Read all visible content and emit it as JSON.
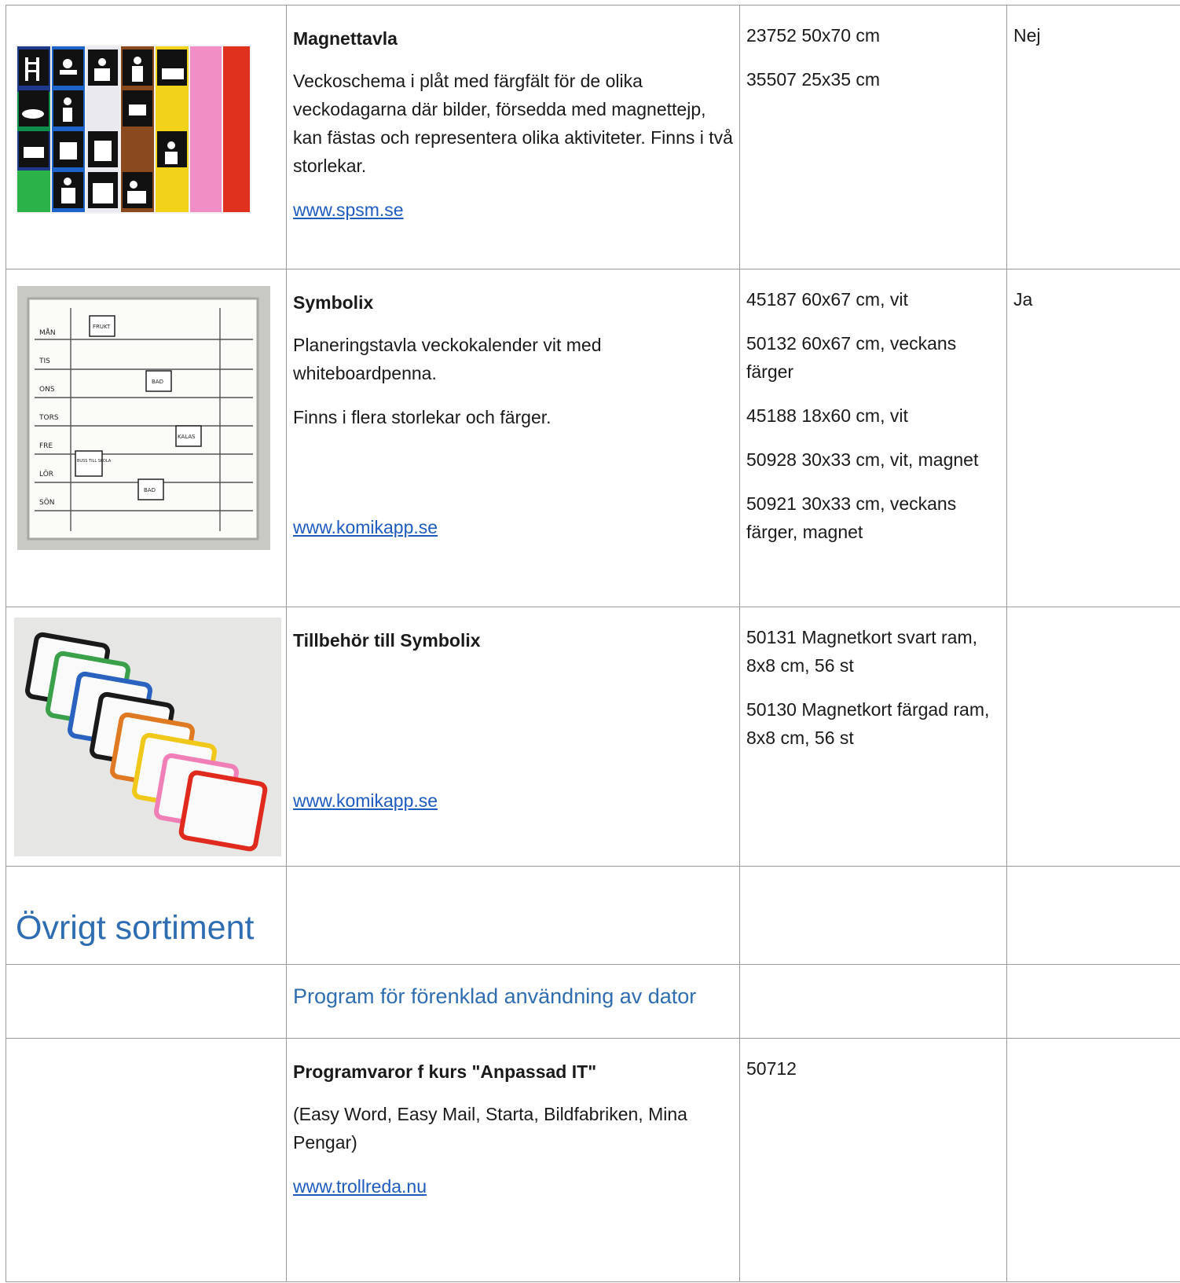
{
  "rows": [
    {
      "title": "Magnettavla",
      "description": "Veckoschema i plåt med färgfält för de olika veckodagarna där bilder, försedda med magnettejp, kan fästas och representera olika aktiviteter. Finns i två storlekar.",
      "link": "www.spsm.se",
      "articles": [
        "23752 50x70 cm",
        "35507 25x35 cm"
      ],
      "extra": "Nej"
    },
    {
      "title": "Symbolix",
      "description": "Planeringstavla veckokalender vit med whiteboardpenna.",
      "description2": "Finns i flera storlekar och färger.",
      "link": "www.komikapp.se",
      "articles": [
        "45187 60x67 cm, vit",
        "50132 60x67 cm, veckans färger",
        "45188 18x60 cm, vit",
        "50928 30x33 cm, vit, magnet",
        "50921 30x33 cm, veckans färger, magnet"
      ],
      "extra": "Ja",
      "board_labels": [
        "MÅN",
        "TIS",
        "ONS",
        "TORS",
        "FRE",
        "LÖR",
        "SÖN"
      ],
      "board_cards": [
        "FRUKT",
        "BAD",
        "KALAS",
        "BUSS TILL SKOLA",
        "BAD"
      ]
    },
    {
      "title": "Tillbehör till Symbolix",
      "link": "www.komikapp.se",
      "articles": [
        "50131 Magnetkort svart ram, 8x8 cm, 56 st",
        "50130 Magnetkort färgad ram, 8x8 cm, 56 st"
      ],
      "extra": ""
    }
  ],
  "section_heading": "Övrigt sortiment",
  "subsection_heading": "Program för förenklad användning av dator",
  "software": {
    "title": "Programvaror f kurs \"Anpassad IT\"",
    "description": "(Easy Word, Easy Mail, Starta, Bildfabriken, Mina Pengar)",
    "link": "www.trollreda.nu",
    "article": "50712"
  },
  "colors": {
    "heading": "#2f6db2",
    "link": "#1e5bbf",
    "border": "#9a9a9a"
  }
}
